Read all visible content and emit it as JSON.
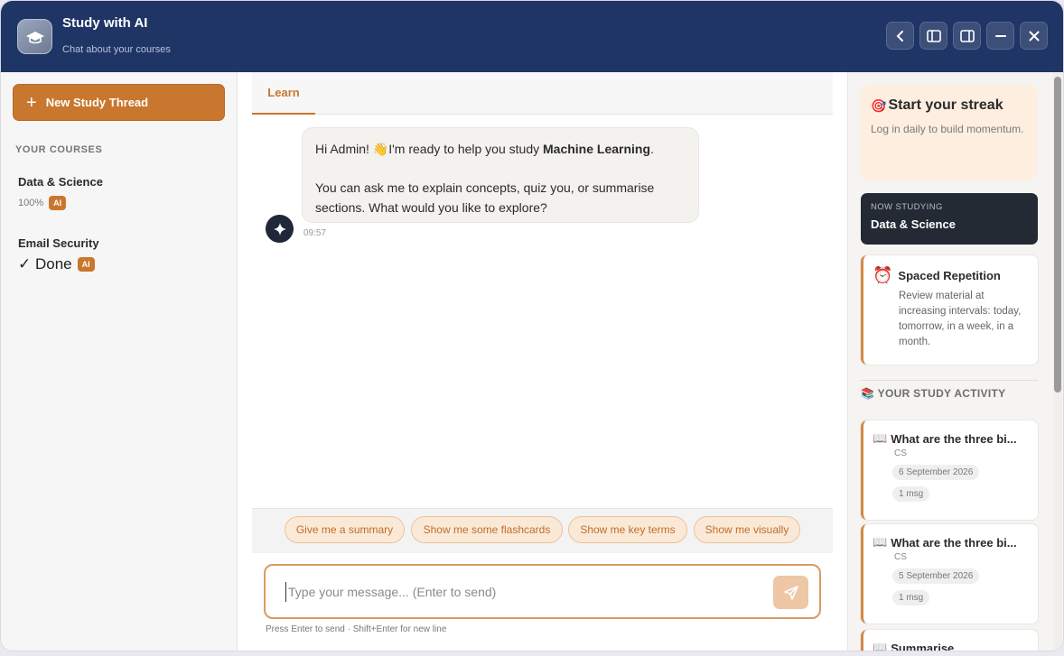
{
  "header": {
    "title": "Study with AI",
    "subtitle": "Chat about your courses",
    "logo_icon": "graduation-cap-icon"
  },
  "sidebar": {
    "new_thread_label": "New Study Thread",
    "courses_heading": "YOUR COURSES",
    "courses": [
      {
        "name": "Data & Science",
        "progress": "100%",
        "badge": "AI"
      },
      {
        "name": "Email Security",
        "status": "✓ Done",
        "badge": "AI"
      }
    ]
  },
  "tabs": [
    {
      "label": "Learn",
      "active": true
    }
  ],
  "chat": {
    "message_intro": "Hi Admin! 👋I'm ready to help you study ",
    "message_course": "Machine Learning",
    "message_end": ".",
    "message_line2": "You can ask me to explain concepts, quiz you, or summarise sections. What would you like to explore?",
    "time": "09:57"
  },
  "suggestions": [
    "Give me a summary",
    "Show me some flashcards",
    "Show me key terms",
    "Show me visually"
  ],
  "composer": {
    "placeholder": "Type your message... (Enter to send)",
    "hint": "Press Enter to send · Shift+Enter for new line"
  },
  "right_panel": {
    "streak_icon": "🎯",
    "streak_title": "Start your streak",
    "streak_text": "Log in daily to build momentum.",
    "now_studying_label": "NOW STUDYING",
    "now_studying_value": "Data & Science",
    "spaced_icon": "⏰",
    "spaced_title": "Spaced Repetition",
    "spaced_text": "Review material at increasing intervals: today, tomorrow, in a week, in a month.",
    "activity_icon": "📚",
    "activity_heading": "YOUR STUDY ACTIVITY",
    "activity": [
      {
        "icon": "📖",
        "title": "What are the three bi...",
        "course": "CS",
        "date": "6 September 2026",
        "count": "1 msg"
      },
      {
        "icon": "📖",
        "title": "What are the three bi...",
        "course": "CS",
        "date": "5 September 2026",
        "count": "1 msg"
      },
      {
        "icon": "📖",
        "title": "Summarise"
      }
    ]
  },
  "colors": {
    "header_bg": "#1f3566",
    "accent": "#c9772e",
    "dark_card": "#232a34"
  }
}
